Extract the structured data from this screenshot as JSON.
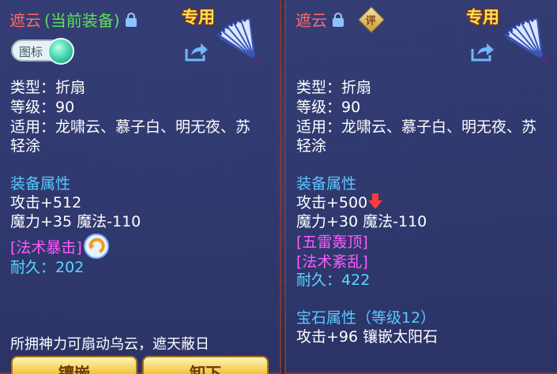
{
  "left_panel": {
    "item_name": "遮云",
    "equip_status": "(当前装备)",
    "exclusive_label": "专用",
    "toggle_label": "图标",
    "type_line": "类型：折扇",
    "level_line": "等级：90",
    "applicable_line1": "适用：龙啸云、慕子白、明无夜、苏",
    "applicable_line2": "轻涂",
    "attr_title": "装备属性",
    "attack": "攻击+512",
    "magic": "魔力+35 魔法-110",
    "skill": "[法术暴击]",
    "durability_label": "耐久：",
    "durability_value": "202",
    "flavor_text": "所拥神力可扇动乌云，遮天蔽日",
    "inlay_button": "镶嵌",
    "unequip_button": "卸下"
  },
  "right_panel": {
    "item_name": "遮云",
    "eval_badge": "评",
    "exclusive_label": "专用",
    "type_line": "类型：折扇",
    "level_line": "等级：90",
    "applicable_line1": "适用：龙啸云、慕子白、明无夜、苏",
    "applicable_line2": "轻涂",
    "attr_title": "装备属性",
    "attack": "攻击+500",
    "magic": "魔力+30 魔法-110",
    "skill1": "[五雷轰顶]",
    "skill2": "[法术紊乱]",
    "durability_label": "耐久：",
    "durability_value": "422",
    "gem_title": "宝石属性（等级12）",
    "gem_line": "攻击+96 镶嵌太阳石"
  },
  "icons": {
    "lock": "lock-icon",
    "share": "share-icon",
    "fan": "fan-icon",
    "refresh": "refresh-icon",
    "down_arrow": "red-down-arrow-icon"
  },
  "colors": {
    "item_name": "#ff6a6a",
    "equipped": "#5de055",
    "section": "#59c8ff",
    "skill": "#ff5aff",
    "exclusive": "#ffe15a"
  }
}
